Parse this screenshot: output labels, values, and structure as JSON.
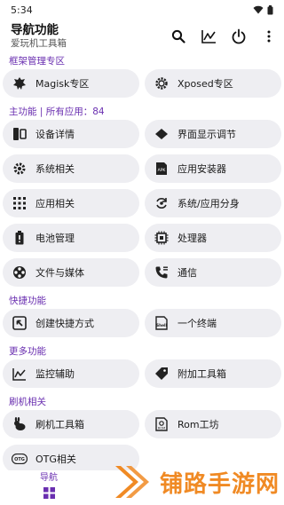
{
  "status": {
    "time": "5:34"
  },
  "header": {
    "title": "导航功能",
    "subtitle": "爱玩机工具箱"
  },
  "sections": {
    "framework": "框架管理专区",
    "main": "主功能 | 所有应用：84",
    "shortcut": "快捷功能",
    "more": "更多功能",
    "flash": "刷机相关"
  },
  "cards": {
    "magisk": "Magisk专区",
    "xposed": "Xposed专区",
    "device": "设备详情",
    "display": "界面显示调节",
    "system": "系统相关",
    "installer": "应用安装器",
    "apps": "应用相关",
    "clone": "系统/应用分身",
    "battery": "电池管理",
    "cpu": "处理器",
    "files": "文件与媒体",
    "comm": "通信",
    "shortcut": "创建快捷方式",
    "terminal": "一个终端",
    "monitor": "监控辅助",
    "extra": "附加工具箱",
    "flashtool": "刷机工具箱",
    "rom": "Rom工坊",
    "otg": "OTG相关"
  },
  "icons": {
    "apk_badge": "APK",
    "shell_badge": "Shell",
    "rom_badge": "ROM",
    "otg_badge": "OTG"
  },
  "nav": {
    "home": "导航"
  },
  "watermark": {
    "text": "铺路手游网"
  },
  "colors": {
    "accent": "#6a2fb0",
    "card": "#eeeef2",
    "watermark": "#f08a24"
  }
}
